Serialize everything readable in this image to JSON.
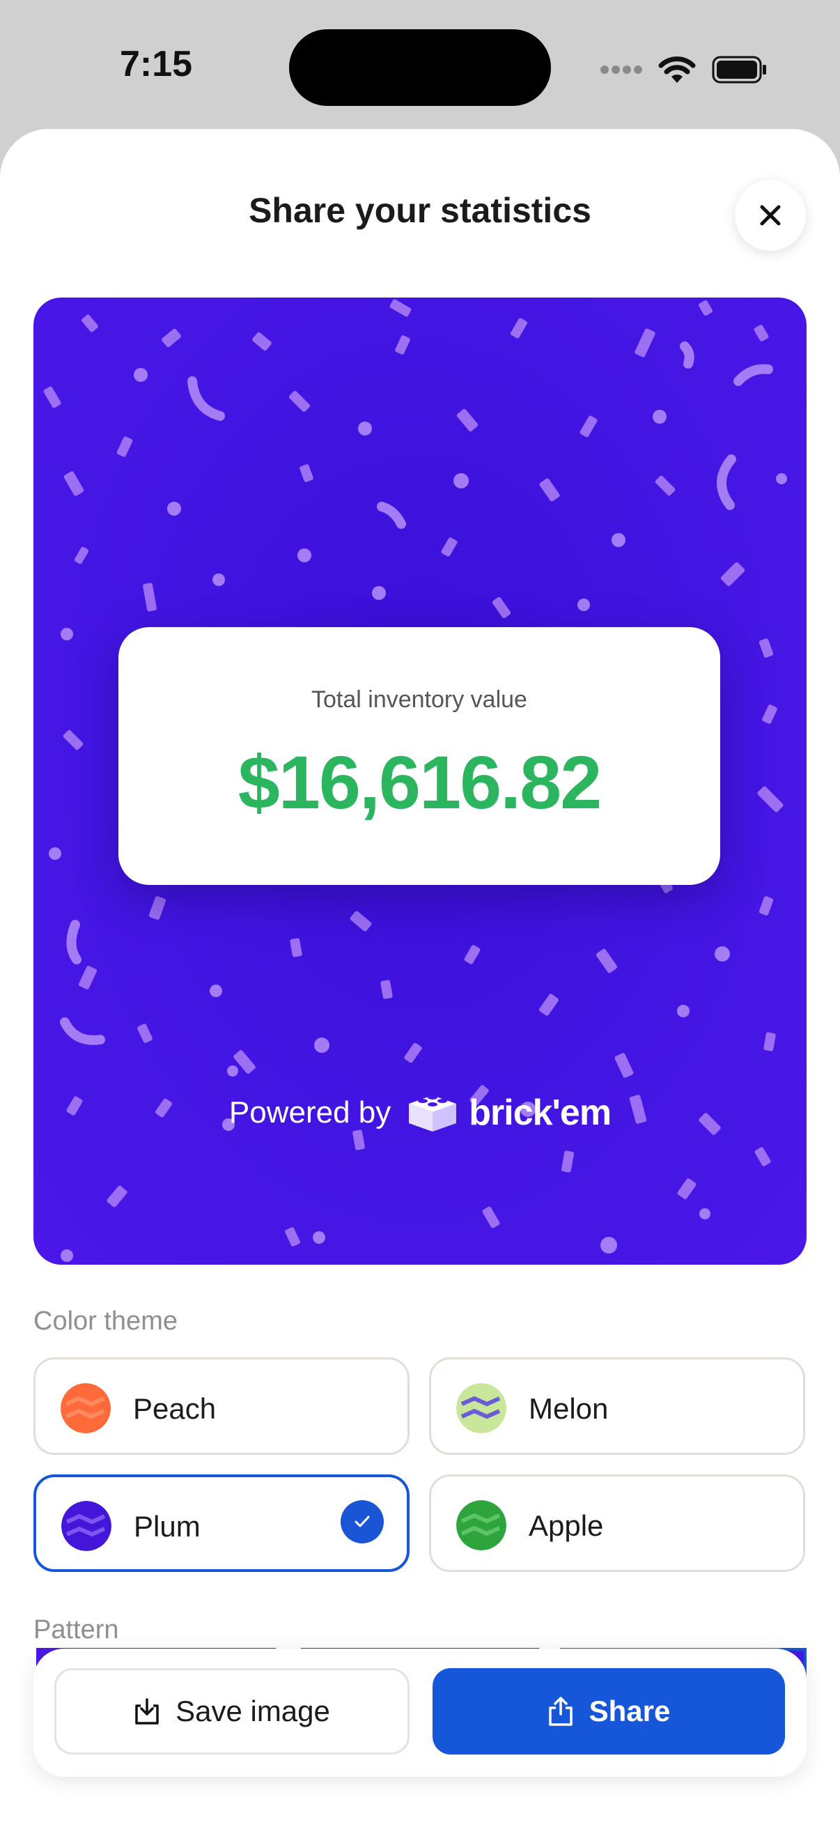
{
  "status_bar": {
    "time": "7:15"
  },
  "sheet": {
    "title": "Share your statistics"
  },
  "stat_card": {
    "label": "Total inventory value",
    "value": "$16,616.82"
  },
  "branding": {
    "powered_by": "Powered by",
    "brand_name": "brick'em"
  },
  "color_theme": {
    "label": "Color theme",
    "options": [
      {
        "name": "Peach",
        "color": "#ff6a3a",
        "selected": false
      },
      {
        "name": "Melon",
        "color": "#c8e79a",
        "selected": false
      },
      {
        "name": "Plum",
        "color": "#4316d9",
        "selected": true
      },
      {
        "name": "Apple",
        "color": "#2ea53c",
        "selected": false
      }
    ]
  },
  "pattern": {
    "label": "Pattern"
  },
  "actions": {
    "save_label": "Save image",
    "share_label": "Share"
  },
  "colors": {
    "accent": "#1656d8",
    "preview_background": "#4315e2",
    "value_green": "#2bb55e",
    "confetti": "#a37cf6"
  }
}
